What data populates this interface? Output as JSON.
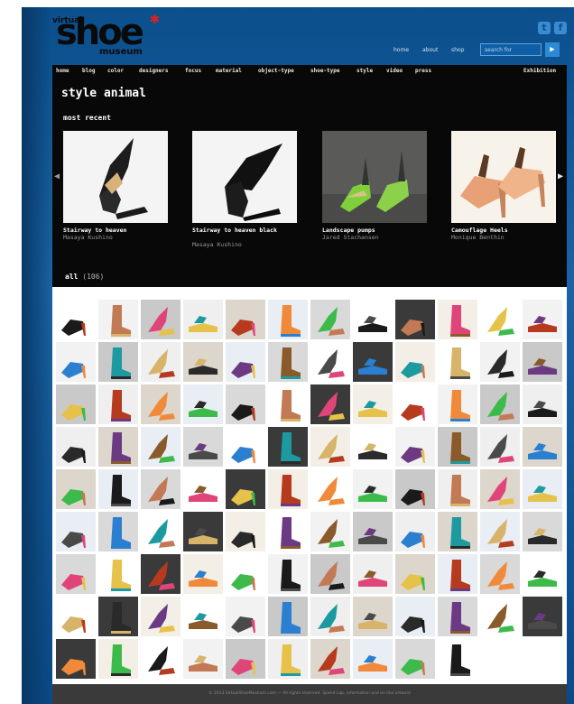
{
  "header": {
    "logo_pre": "virtual",
    "logo_main": "shoe",
    "logo_post": "museum",
    "top_links": [
      "home",
      "about",
      "shop"
    ],
    "search_placeholder": "search for",
    "search_button": "▶",
    "social_icons": [
      "twitter-icon",
      "facebook-icon"
    ]
  },
  "nav": {
    "items": [
      "home",
      "blog",
      "color",
      "designers",
      "focus",
      "material",
      "object-type",
      "shoe-type",
      "style",
      "video",
      "press"
    ],
    "right": "Exhibition"
  },
  "page": {
    "title": "style animal",
    "recent_heading": "most recent",
    "prev_arrow": "◀",
    "next_arrow": "▶"
  },
  "featured": [
    {
      "title": "Stairway to heaven",
      "designer": "Masaya Kushino"
    },
    {
      "title": "Stairway to heaven black",
      "designer": "Masaya Kushino"
    },
    {
      "title": "Landscape pumps",
      "designer": "Jared Stachansen"
    },
    {
      "title": "Camouflage Heels",
      "designer": "Monique Benthin"
    }
  ],
  "all_section": {
    "label": "all",
    "count": "(106)"
  },
  "grid_rows": 9,
  "grid_cols": 12,
  "grid_filled": 106,
  "footer": {
    "text": "© 2013 VirtualShoeMuseum.com — All rights reserved. Sjoerd Lap, information and on line artwork"
  }
}
